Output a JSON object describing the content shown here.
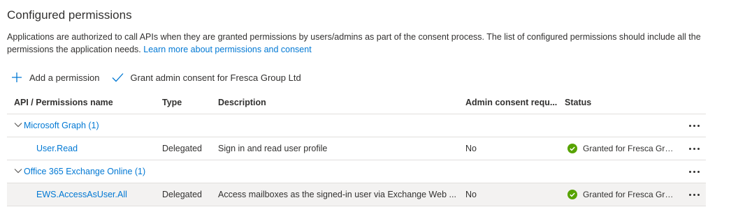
{
  "section": {
    "title": "Configured permissions",
    "description": "Applications are authorized to call APIs when they are granted permissions by users/admins as part of the consent process. The list of configured permissions should include all the permissions the application needs.",
    "learn_more": "Learn more about permissions and consent"
  },
  "toolbar": {
    "add_label": "Add a permission",
    "grant_label": "Grant admin consent for Fresca Group Ltd"
  },
  "table": {
    "headers": {
      "api": "API / Permissions name",
      "type": "Type",
      "description": "Description",
      "admin": "Admin consent requ...",
      "status": "Status"
    },
    "groups": [
      {
        "name": "Microsoft Graph (1)",
        "permissions": [
          {
            "name": "User.Read",
            "type": "Delegated",
            "description": "Sign in and read user profile",
            "admin": "No",
            "status": "Granted for Fresca Grou..."
          }
        ]
      },
      {
        "name": "Office 365 Exchange Online (1)",
        "permissions": [
          {
            "name": "EWS.AccessAsUser.All",
            "type": "Delegated",
            "description": "Access mailboxes as the signed-in user via Exchange Web ...",
            "admin": "No",
            "status": "Granted for Fresca Grou..."
          }
        ]
      }
    ]
  },
  "colors": {
    "link": "#0078d4",
    "success": "#57a300",
    "selected_row": "#f3f2f1"
  },
  "icons": {
    "add": "plus-icon",
    "grant": "checkmark-icon",
    "expand": "chevron-down-icon",
    "granted": "check-circle-icon",
    "more": "more-icon"
  }
}
